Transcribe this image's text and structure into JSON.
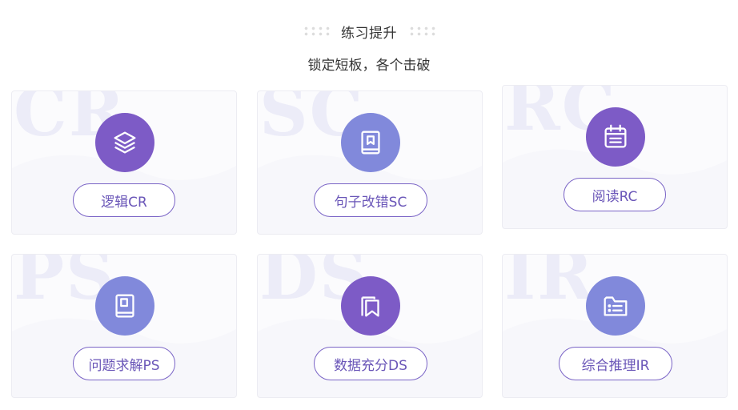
{
  "header": {
    "title": "练习提升",
    "subtitle": "锁定短板，各个击破"
  },
  "colors": {
    "purple_dark": "#7d5bc6",
    "purple_light": "#8189db",
    "pill_border": "#7a64c6",
    "card_bg": "#f7f7fb"
  },
  "cards": [
    {
      "bg_text": "CR",
      "label": "逻辑CR",
      "icon": "layers-icon",
      "icon_color": "#7d5bc6"
    },
    {
      "bg_text": "SC",
      "label": "句子改错SC",
      "icon": "bookmark-book-icon",
      "icon_color": "#8189db"
    },
    {
      "bg_text": "RC",
      "label": "阅读RC",
      "icon": "calendar-icon",
      "icon_color": "#7d5bc6"
    },
    {
      "bg_text": "PS",
      "label": "问题求解PS",
      "icon": "book-icon",
      "icon_color": "#8189db"
    },
    {
      "bg_text": "DS",
      "label": "数据充分DS",
      "icon": "bookmark-icon",
      "icon_color": "#7d5bc6"
    },
    {
      "bg_text": "IR",
      "label": "综合推理IR",
      "icon": "folder-list-icon",
      "icon_color": "#8189db"
    }
  ]
}
